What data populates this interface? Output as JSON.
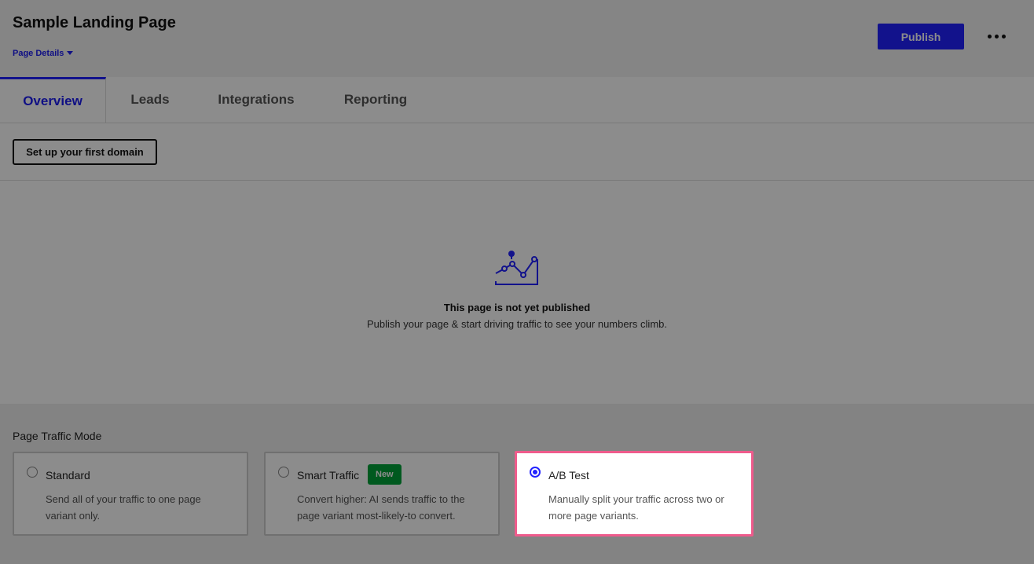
{
  "header": {
    "title": "Sample Landing Page",
    "page_details_label": "Page Details",
    "publish_label": "Publish"
  },
  "tabs": [
    {
      "label": "Overview",
      "active": true
    },
    {
      "label": "Leads",
      "active": false
    },
    {
      "label": "Integrations",
      "active": false
    },
    {
      "label": "Reporting",
      "active": false
    }
  ],
  "domain": {
    "button_label": "Set up your first domain"
  },
  "empty_state": {
    "icon": "chart-line-icon",
    "headline": "This page is not yet published",
    "subtext": "Publish your page & start driving traffic to see your numbers climb."
  },
  "traffic_mode": {
    "title": "Page Traffic Mode",
    "options": [
      {
        "label": "Standard",
        "description": "Send all of your traffic to one page variant only.",
        "selected": false
      },
      {
        "label": "Smart Traffic",
        "badge": "New",
        "description": "Convert higher: AI sends traffic to the page variant most-likely-to convert.",
        "selected": false
      },
      {
        "label": "A/B Test",
        "description": "Manually split your traffic across two or more page variants.",
        "selected": true
      }
    ]
  },
  "colors": {
    "accent": "#2222ff",
    "highlight_border": "#ef5b8c",
    "badge_green": "#00a23a"
  }
}
